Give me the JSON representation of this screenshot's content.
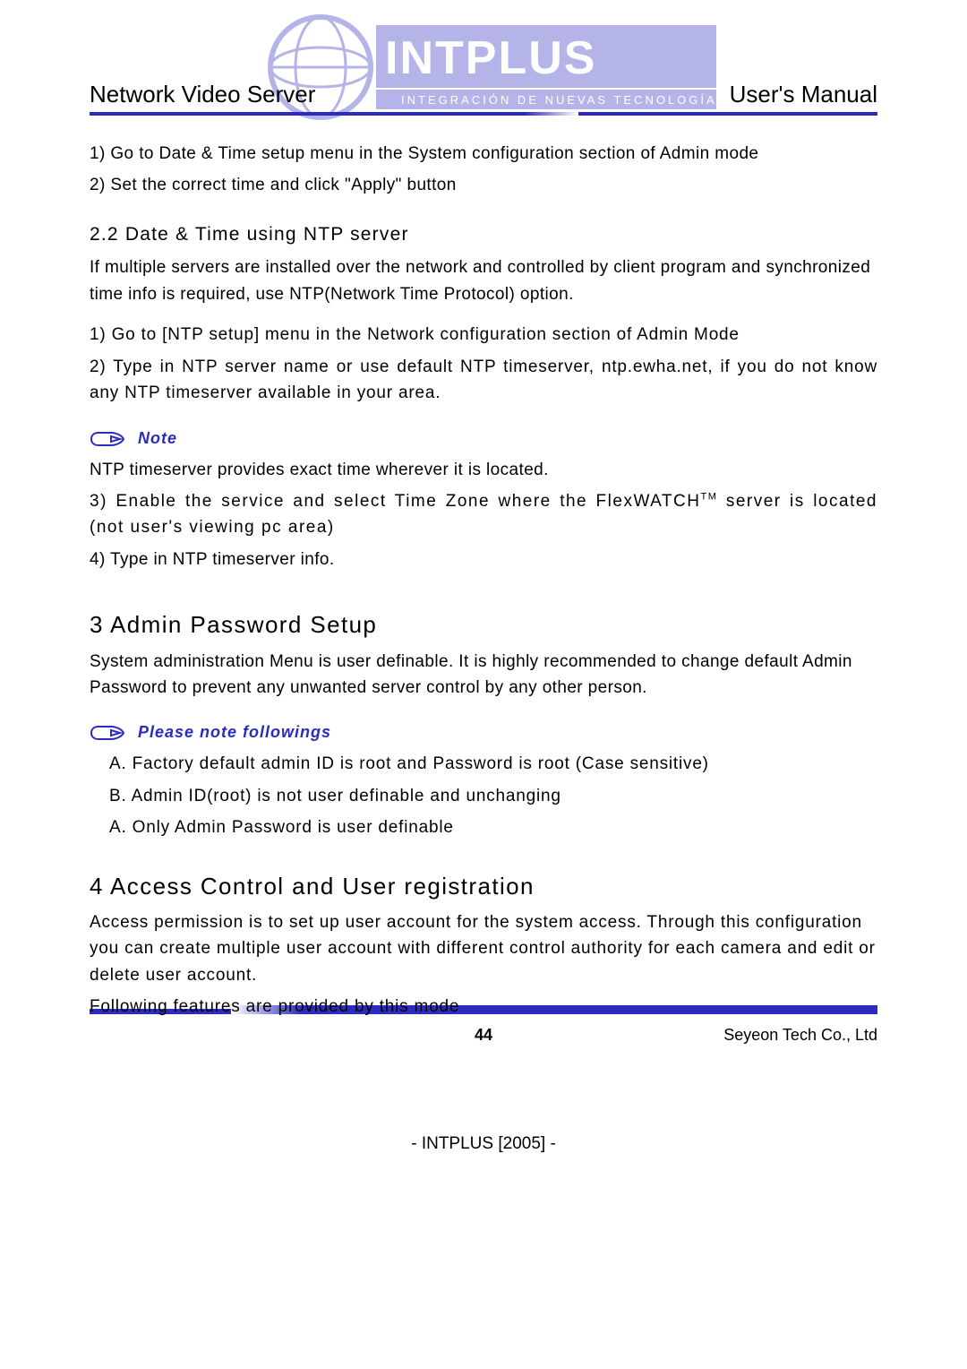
{
  "header": {
    "left": "Network Video Server",
    "right": "User's Manual"
  },
  "watermark": {
    "brand": "INTPLUS",
    "tagline": "INTEGRACIÓN DE NUEVAS TECNOLOGÍAS"
  },
  "steps_intro": {
    "s1": "1) Go to Date & Time setup menu in the System configuration section of Admin mode",
    "s2": "2) Set the correct time and click \"Apply\" button"
  },
  "section22": {
    "title": "2.2 Date & Time using NTP server",
    "para": "If multiple servers are installed over the network and controlled by client program and synchronized time info is required, use NTP(Network Time Protocol) option.",
    "s1": "1) Go to [NTP setup] menu in the Network configuration section of Admin Mode",
    "s2": "2) Type in NTP server name or use default NTP timeserver, ntp.ewha.net, if you do not know any NTP timeserver available in your area."
  },
  "note": {
    "label": "Note",
    "text": "NTP timeserver provides exact time wherever it is located.",
    "s3a": "3) Enable the service and select Time Zone where the FlexWATCH",
    "tm": "TM",
    "s3b": " server is located (not user's viewing pc area)",
    "s4": "4) Type in NTP timeserver info."
  },
  "section3": {
    "title": "3 Admin Password Setup",
    "para": "System administration Menu is user definable. It is highly recommended to change default Admin Password to prevent any unwanted server control by any other person."
  },
  "please_note": {
    "label": "Please note followings",
    "a": "A. Factory default admin ID is root and Password is root (Case sensitive)",
    "b": "B. Admin ID(root) is not user definable and unchanging",
    "c": "A. Only Admin Password is user definable"
  },
  "section4": {
    "title": "4 Access Control and User registration",
    "para": "Access permission is to set up user account for the system access. Through this configuration you can create multiple user account with different control authority for each camera and edit or delete user account.",
    "para2": "Following features are provided by this mode"
  },
  "footer": {
    "page": "44",
    "company": "Seyeon Tech Co., Ltd",
    "bottom": "- INTPLUS [2005] -"
  }
}
